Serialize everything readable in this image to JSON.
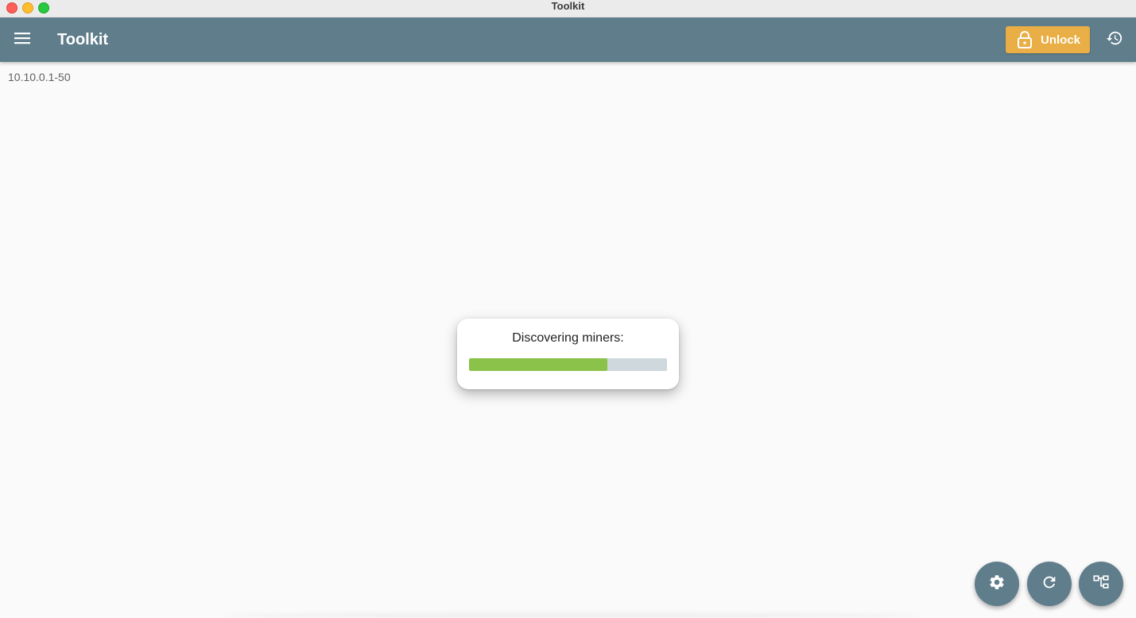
{
  "window": {
    "title": "Toolkit"
  },
  "appbar": {
    "menu_icon": "menu-icon",
    "title": "Toolkit",
    "unlock_label": "Unlock",
    "unlock_icon": "lock-icon",
    "history_icon": "history-icon",
    "background": "#607d8b",
    "unlock_color": "#e9ae45"
  },
  "main": {
    "ip_range": "10.10.0.1-50"
  },
  "dialog": {
    "title": "Discovering miners:",
    "progress_fraction": 0.7,
    "progress_color": "#8bc34a",
    "track_color": "#cfd8dc"
  },
  "fabs": [
    {
      "icon": "gear-icon"
    },
    {
      "icon": "refresh-icon"
    },
    {
      "icon": "network-tree-icon"
    }
  ]
}
